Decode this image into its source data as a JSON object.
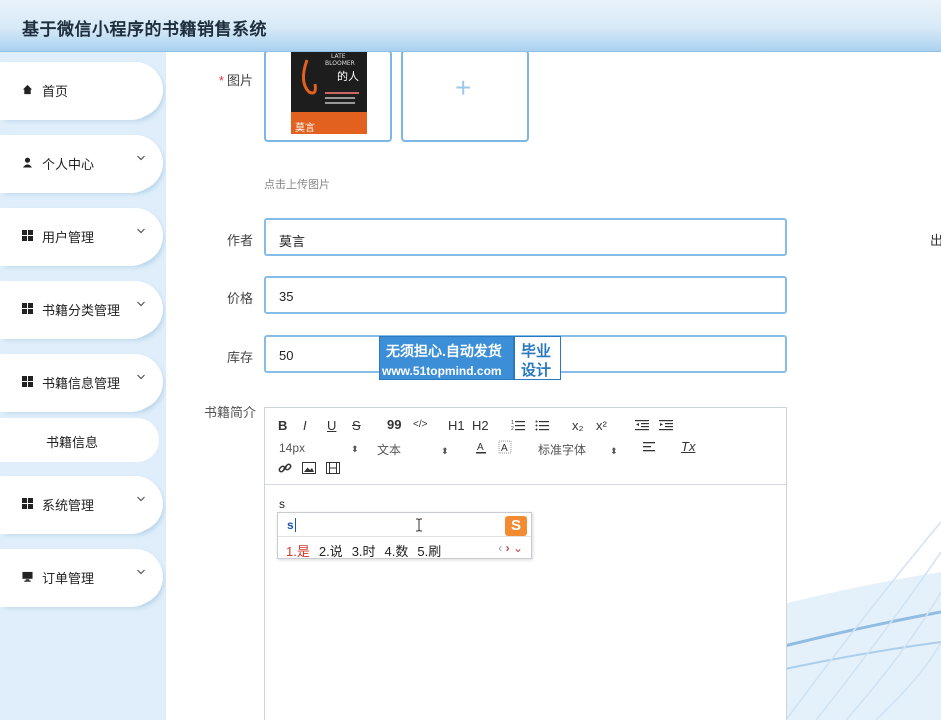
{
  "app": {
    "title": "基于微信小程序的书籍销售系统"
  },
  "sidebar": {
    "items": [
      {
        "label": "首页",
        "icon": "home-icon"
      },
      {
        "label": "个人中心",
        "icon": "user-icon"
      },
      {
        "label": "用户管理",
        "icon": "grid-icon"
      },
      {
        "label": "书籍分类管理",
        "icon": "grid-icon"
      },
      {
        "label": "书籍信息管理",
        "icon": "grid-icon"
      },
      {
        "label": "书籍信息"
      },
      {
        "label": "系统管理",
        "icon": "grid-icon"
      },
      {
        "label": "订单管理",
        "icon": "monitor-icon"
      }
    ]
  },
  "form": {
    "image_label": "图片",
    "upload_hint": "点击上传图片",
    "author_label": "作者",
    "author_value": "莫言",
    "price_label": "价格",
    "price_value": "35",
    "stock_label": "库存",
    "stock_value": "50",
    "intro_label": "书籍简介",
    "edge_label": "出",
    "cover": {
      "line1": "LATE",
      "line2": "BLOOMER",
      "title": "的人",
      "author": "莫言"
    }
  },
  "editor": {
    "font_size": "14px",
    "text_type": "文本",
    "font_family": "标准字体",
    "content": "s",
    "toolbar_marks": [
      "B",
      "I",
      "U",
      "S",
      "99",
      "</>",
      "H1",
      "H2",
      "x₂",
      "x²",
      "Tx"
    ]
  },
  "ime": {
    "input": "s",
    "logo": "S",
    "candidates": [
      "1.是",
      "2.说",
      "3.时",
      "4.数",
      "5.刷"
    ]
  },
  "watermark": {
    "line1": "无须担心.自动发货",
    "line2": "www.51topmind.com",
    "right1": "毕业",
    "right2": "设计"
  }
}
